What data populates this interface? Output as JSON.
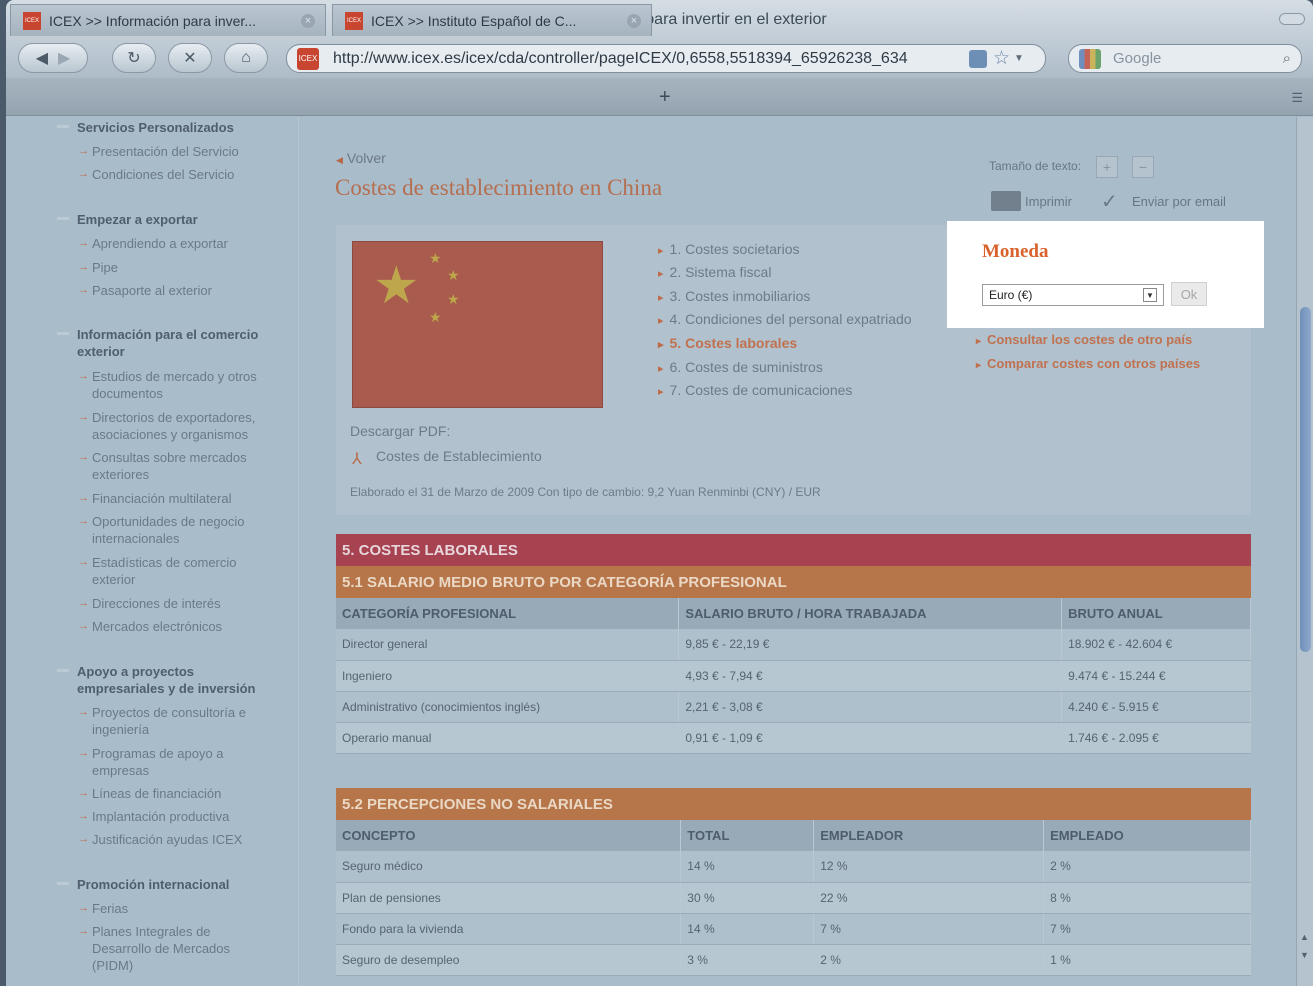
{
  "window": {
    "title": "ICEX >> Información para invertir en el exterior"
  },
  "toolbar": {
    "back_label": "◀",
    "forward_label": "▶",
    "reload_label": "↻",
    "stop_label": "✕",
    "home_label": "⌂",
    "url": "http://www.icex.es/icex/cda/controller/pageICEX/0,6558,5518394_65926238_634",
    "favicon_text": "ICEX",
    "search_placeholder": "Google"
  },
  "tabs": [
    {
      "label": "ICEX >> Información para inver...",
      "active": true
    },
    {
      "label": "ICEX >> Instituto Español de C...",
      "active": false
    }
  ],
  "newtab_label": "+",
  "sidebar": {
    "sections": [
      {
        "title": "Servicios Personalizados",
        "items": [
          "Presentación del Servicio",
          "Condiciones del Servicio"
        ]
      },
      {
        "title": "Empezar a exportar",
        "items": [
          "Aprendiendo a exportar",
          "Pipe",
          "Pasaporte al exterior"
        ]
      },
      {
        "title": "Información para el comercio exterior",
        "items": [
          "Estudios de mercado y otros documentos",
          "Directorios de exportadores, asociaciones y organismos",
          "Consultas sobre mercados exteriores",
          "Financiación multilateral",
          "Oportunidades de negocio internacionales",
          "Estadísticas de comercio exterior",
          "Direcciones de interés",
          "Mercados electrónicos"
        ]
      },
      {
        "title": "Apoyo a proyectos empresariales y de inversión",
        "items": [
          "Proyectos de consultoría e ingeniería",
          "Programas de apoyo a empresas",
          "Líneas de financiación",
          "Implantación productiva",
          "Justificación ayudas ICEX"
        ]
      },
      {
        "title": "Promoción internacional",
        "items": [
          "Ferias",
          "Planes Integrales de Desarrollo de Mercados (PIDM)"
        ]
      }
    ]
  },
  "main": {
    "back_label": "Volver",
    "title": "Costes de establecimiento en China",
    "text_size_label": "Tamaño de texto:",
    "size_plus": "+",
    "size_minus": "−",
    "print_label": "Imprimir",
    "email_label": "Enviar por email",
    "toc": [
      "1. Costes societarios",
      "2. Sistema fiscal",
      "3. Costes inmobiliarios",
      "4. Condiciones del personal expatriado",
      "5. Costes laborales",
      "6. Costes de suministros",
      "7. Costes de comunicaciones"
    ],
    "toc_active_index": 4,
    "download_label": "Descargar PDF:",
    "pdf_link": "Costes de Establecimiento",
    "elaborado": "Elaborado el 31 de Marzo de 2009 Con tipo de cambio: 9,2 Yuan Renminbi (CNY) / EUR",
    "links": [
      "Consultar los costes de otro país",
      "Comparar costes con otros países"
    ],
    "moneda": {
      "title": "Moneda",
      "selected": "Euro (€)",
      "ok_label": "Ok"
    }
  },
  "section5": {
    "title": "5. COSTES LABORALES",
    "table1": {
      "title": "5.1 SALARIO MEDIO BRUTO POR CATEGORÍA PROFESIONAL",
      "headers": [
        "CATEGORÍA PROFESIONAL",
        "SALARIO BRUTO / HORA TRABAJADA",
        "BRUTO ANUAL"
      ],
      "rows": [
        [
          "Director general",
          "9,85 € - 22,19 €",
          "18.902 € - 42.604 €"
        ],
        [
          "Ingeniero",
          "4,93 € - 7,94 €",
          "9.474 € - 15.244 €"
        ],
        [
          "Administrativo (conocimientos inglés)",
          "2,21 € - 3,08 €",
          "4.240 € - 5.915 €"
        ],
        [
          "Operario manual",
          "0,91 € - 1,09 €",
          "1.746 € - 2.095 €"
        ]
      ]
    },
    "table2": {
      "title": "5.2 PERCEPCIONES NO SALARIALES",
      "headers": [
        "CONCEPTO",
        "TOTAL",
        "EMPLEADOR",
        "EMPLEADO"
      ],
      "rows": [
        [
          "Seguro médico",
          "14 %",
          "12 %",
          "2 %"
        ],
        [
          "Plan de pensiones",
          "30 %",
          "22 %",
          "8 %"
        ],
        [
          "Fondo para la vivienda",
          "14 %",
          "7 %",
          "7 %"
        ],
        [
          "Seguro de desempleo",
          "3 %",
          "2 %",
          "1 %"
        ]
      ]
    }
  },
  "colors": {
    "accent": "#d9622c",
    "band_red": "#a74351",
    "band_orange": "#b6764a"
  }
}
